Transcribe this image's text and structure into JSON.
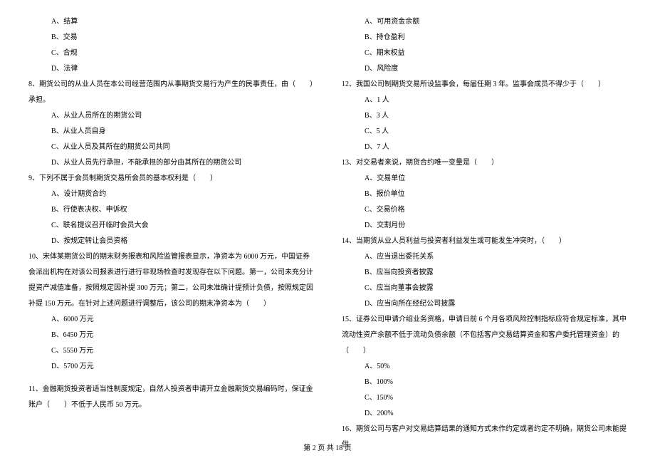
{
  "left_column": {
    "q7_options": [
      "A、结算",
      "B、交易",
      "C、合规",
      "D、法律"
    ],
    "q8_text": "8、期货公司的从业人员在本公司经营范围内从事期货交易行为产生的民事责任，由（　　）承担。",
    "q8_options": [
      "A、从业人员所在的期货公司",
      "B、从业人员自身",
      "C、从业人员及其所在的期货公司共同",
      "D、从业人员先行承担，不能承担的部分由其所在的期货公司"
    ],
    "q9_text": "9、下列不属于会员制期货交易所会员的基本权利是（　　）",
    "q9_options": [
      "A、设计期货合约",
      "B、行使表决权、申诉权",
      "C、联名提议召开临时会员大会",
      "D、按规定转让会员资格"
    ],
    "q10_text": "10、宋体某期货公司的期末财务报表和风险监管报表显示，净资本为 6000 万元，中国证券会派出机构在对该公司报表进行进行非现场检查时发现存在以下问题。第一，公司未充分计提资产减值准备，按照规定因补提 300 万元；第二，公司未准确计提预计负债，按照规定因补提 150 万元。在针对上述问题进行调整后，该公司的期末净资本为（　　）",
    "q10_options": [
      "A、6000 万元",
      "B、6450 万元",
      "C、5550 万元",
      "D、5700 万元"
    ],
    "q11_text": "11、金融期货投资者适当性制度规定，自然人投资者申请开立金融期货交易编码时，保证金账户（　　）不低于人民币 50 万元。"
  },
  "right_column": {
    "q11_options": [
      "A、可用资金余额",
      "B、持仓盈利",
      "C、期末权益",
      "D、风险度"
    ],
    "q12_text": "12、我国公司制期货交易所设监事会，每届任期 3 年。监事会成员不得少于（　　）",
    "q12_options": [
      "A、1 人",
      "B、3 人",
      "C、5 人",
      "D、7 人"
    ],
    "q13_text": "13、对交易者来说，期货合约唯一变量是（　　）",
    "q13_options": [
      "A、交易单位",
      "B、报价单位",
      "C、交易价格",
      "D、交割月份"
    ],
    "q14_text": "14、当期货从业人员利益与投资者利益发生或可能发生冲突时，（　　）",
    "q14_options": [
      "A、应当退出委托关系",
      "B、应当向投资者披露",
      "C、应当向董事会披露",
      "D、应当向所在经纪公司披露"
    ],
    "q15_text": "15、证券公司申请介绍业务资格，申请日前 6 个月各项风险控制指标应符合规定标准，其中流动性资产余额不低于流动负债余额（不包括客户交易结算资金和客户委托管理资金）的（　　）",
    "q15_options": [
      "A、50%",
      "B、100%",
      "C、150%",
      "D、200%"
    ],
    "q16_text": "16、期货公司与客户对交易结算结果的通知方式未作约定或者约定不明确，期货公司未能提供"
  },
  "footer": "第 2 页 共 18 页"
}
